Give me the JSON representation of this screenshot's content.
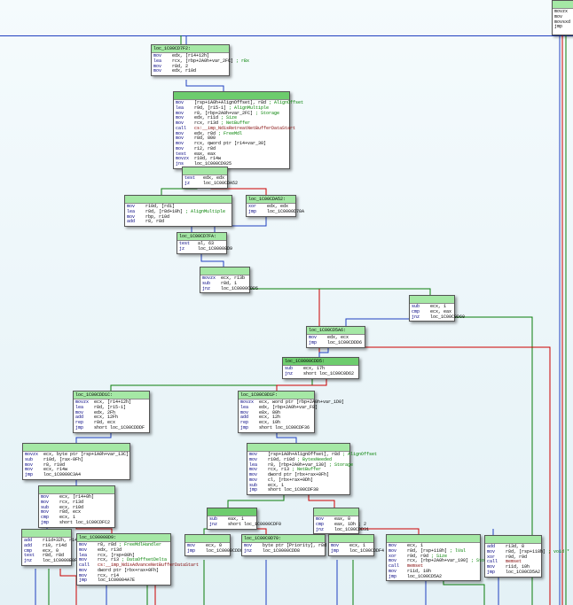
{
  "rf": [
    "movzx",
    "mov",
    "movsxd",
    "jmp"
  ],
  "n1": {
    "label": "loc_1C00CD7F2:",
    "lines": [
      {
        "op": "mov",
        "a": "edx, [r14+12h]"
      },
      {
        "op": "lea",
        "a": "rcx, [rbp+2A0h+var_2FC]",
        "c": "; rBx"
      },
      {
        "op": "mov",
        "a": "r8d, 2"
      },
      {
        "op": "mov",
        "a": "edx, r10d"
      }
    ]
  },
  "n2": {
    "lines": [
      {
        "op": "mov",
        "a": "[rsp+1A0h+AlignOffset], r8d",
        "c": "; AlignOffset"
      },
      {
        "op": "lea",
        "a": "r9d, [r15-1]",
        "c": "; AlignMultiple"
      },
      {
        "op": "mov",
        "a": "r8, [rbp+2A0h+var_2FC]",
        "c": "; Storage"
      },
      {
        "op": "mov",
        "a": "edx, r11d",
        "c": "; Size"
      },
      {
        "op": "mov",
        "a": "rcx, r13d",
        "c": "; NetBuffer"
      },
      {
        "op": "call",
        "a": "",
        "fn": "cs:__imp_NdisRetreatNetBufferDataStart"
      },
      {
        "op": "mov",
        "a": "edx, r8d",
        "c": "; FreeMdl"
      },
      {
        "op": "mov",
        "a": "r8d, 800"
      },
      {
        "op": "mov",
        "a": "rcx, qword ptr [r14+var_30]"
      },
      {
        "op": "mov",
        "a": "r12, r8d"
      },
      {
        "op": "test",
        "a": "eax, eax"
      },
      {
        "op": "movzx",
        "a": "r10d, r14w"
      },
      {
        "op": "jns",
        "a": "loc_1C000CD925"
      }
    ]
  },
  "pill": {
    "lines": [
      {
        "op": "test",
        "a": "edx, edx"
      },
      {
        "op": "jz",
        "a": "loc_1C00CDA52"
      }
    ]
  },
  "n3a": {
    "lines": [
      {
        "op": "mov",
        "a": "r10d, [rdi]",
        "c": ""
      },
      {
        "op": "lea",
        "a": "r8d, [r8d+10h]",
        "c": "; AlignMultiple"
      },
      {
        "op": "mov",
        "a": "rbp, r10d"
      },
      {
        "op": "add",
        "a": "r8, r8d"
      }
    ]
  },
  "n3b": {
    "label": "loc_1C00CDA52:",
    "lines": [
      {
        "op": "xor",
        "a": "edx, edx"
      },
      {
        "op": "jmp",
        "a": "loc_1C0000D70A"
      }
    ]
  },
  "n4": {
    "label": "loc_1C00CD7FA:",
    "lines": [
      {
        "op": "test",
        "a": "al, 63"
      },
      {
        "op": "jz",
        "a": "loc_1C00008D9"
      }
    ]
  },
  "n5": {
    "lines": [
      {
        "op": "movzx",
        "a": "ecx, r13b"
      },
      {
        "op": "sub",
        "a": "r8d, 1"
      },
      {
        "op": "jnz",
        "a": "loc_1C0000CDD5"
      }
    ]
  },
  "n6b": {
    "lines": [
      {
        "op": "sub",
        "a": "ecx, 1"
      },
      {
        "op": "cmp",
        "a": "ecx, eax"
      },
      {
        "op": "jnz",
        "a": "loc_1C00C0D60"
      }
    ]
  },
  "n7": {
    "label": "loc_1C00CD5A6:",
    "lines": [
      {
        "op": "mov",
        "a": "edx, ecx"
      },
      {
        "op": "jmp",
        "a": "loc_1C00CDDD6"
      }
    ]
  },
  "n8": {
    "label": "loc_1C0000CDD5:",
    "lines": [
      {
        "op": "sub",
        "a": "ecx, 17h"
      },
      {
        "op": "jnz",
        "a": "short loc_1C00C0D62"
      }
    ]
  },
  "n9a": {
    "label": "loc_1C00CDD1C:",
    "lines": [
      {
        "op": "movzx",
        "a": "ecx, [r14+12h]"
      },
      {
        "op": "lea",
        "a": "r8d, [r15-1]"
      },
      {
        "op": "mov",
        "a": "edx, 2Fh"
      },
      {
        "op": "add",
        "a": "ecx, 12Fh"
      },
      {
        "op": "rep",
        "a": "r8d, ecx"
      },
      {
        "op": "jmp",
        "a": "short loc_1C00CDDDF"
      }
    ]
  },
  "n9b": {
    "label": "loc_1C00C0D1F:",
    "lines": [
      {
        "op": "movzx",
        "a": "ecx, word ptr [rbp+2A0h+var_1D0]"
      },
      {
        "op": "lea",
        "a": "edx, [rbp+2A0h+var_F8]"
      },
      {
        "op": "mov",
        "a": "e8x, 80h"
      },
      {
        "op": "add",
        "a": "ecx, 12h"
      },
      {
        "op": "rep",
        "a": "ecx, 10h"
      },
      {
        "op": "jmp",
        "a": "short loc_1C00CDF36"
      }
    ]
  },
  "n10a": {
    "lines": [
      {
        "op": "movzx",
        "a": "ecx, byte ptr [rsp+1A0h+var_13C]"
      },
      {
        "op": "sub",
        "a": "r10d, [rax-0Fh]"
      },
      {
        "op": "mov",
        "a": "r8, r10d"
      },
      {
        "op": "mov",
        "a": "ecx, r14w"
      },
      {
        "op": "jmp",
        "a": "loc_1C0000C3A4"
      }
    ]
  },
  "n10b": {
    "lines": [
      {
        "op": "mov",
        "a": "[rsp+1A0h+AlignOffset], r8d",
        "c": "; AlignOffset"
      },
      {
        "op": "mov",
        "a": "r10d, r10d",
        "c": "; BytesNeeded"
      },
      {
        "op": "lea",
        "a": "r8, [rbp+2A0h+var_130]",
        "c": "; Storage"
      },
      {
        "op": "mov",
        "a": "rcx, r13",
        "c": "; NetBuffer"
      },
      {
        "op": "mov",
        "a": "dword ptr [rbx+rax+0Fh]"
      },
      {
        "op": "mov",
        "a": "cl, [rbx+rax+0Dh]"
      },
      {
        "op": "sub",
        "a": "ecx, 1"
      },
      {
        "op": "jmp",
        "a": "short loc_1C00CDF38"
      }
    ]
  },
  "n11a": {
    "lines": [
      {
        "op": "mov",
        "a": "ecx, [r14+0h]"
      },
      {
        "op": "mov",
        "a": "rcx, r13d"
      },
      {
        "op": "sub",
        "a": "ecx, r10d"
      },
      {
        "op": "mov",
        "a": "r8d, ecx"
      },
      {
        "op": "cmp",
        "a": "ecx, 1"
      },
      {
        "op": "jmp",
        "a": "short loc_1C00CDFC2"
      }
    ]
  },
  "n11b": {
    "lines": [
      {
        "op": "sub",
        "a": "eax, 1"
      },
      {
        "op": "jnz",
        "a": "short loc_1C0000CDF0"
      }
    ]
  },
  "n11c": {
    "lines": [
      {
        "op": "mov",
        "a": "eax, 0"
      },
      {
        "op": "cmp",
        "a": "eax, 1Dh ; 2"
      },
      {
        "op": "jnz",
        "a": "loc_1C00CDD31"
      }
    ]
  },
  "n12a": {
    "lines": [
      {
        "op": "add",
        "a": "r11d+32h, r14d"
      },
      {
        "op": "add",
        "a": "r10, r14d"
      },
      {
        "op": "cmp",
        "a": "ecx, 0"
      },
      {
        "op": "test",
        "a": "r8d, r8d"
      },
      {
        "op": "jnz",
        "a": "loc_1C0000E0FC"
      }
    ]
  },
  "n12b": {
    "label": "loc_1C00008D9:",
    "lines": [
      {
        "op": "mov",
        "a": "r8, r8d",
        "c": "; FreeMdlHandler"
      },
      {
        "op": "mov",
        "a": "edx, r13d"
      },
      {
        "op": "lea",
        "a": "rcx, [rsp+80h]"
      },
      {
        "op": "mov",
        "a": "rcx, r13",
        "c": "; DataOffsetDelta"
      },
      {
        "op": "call",
        "a": "",
        "fn": "cs:__imp_NdisAdvanceNetBufferDataStart"
      },
      {
        "op": "mov",
        "a": "dword ptr [rbx+rax+0Fh]"
      },
      {
        "op": "mov",
        "a": "rcx, r14"
      },
      {
        "op": "jmp",
        "a": "loc_1C00004A7E"
      }
    ]
  },
  "n12e": {
    "lines": [
      {
        "op": "mov",
        "a": "ecx, 0"
      },
      {
        "op": "jmp",
        "a": "loc_1C0000CDD8"
      }
    ]
  },
  "n12f": {
    "label": "loc_1C00C0D70:",
    "lines": [
      {
        "op": "mov",
        "a": "byte ptr [Priority], r8d"
      },
      {
        "op": "jnz",
        "a": "loc_1C0000CDD8"
      }
    ]
  },
  "n12g": {
    "lines": [
      {
        "op": "mov",
        "a": "ecx, 1"
      },
      {
        "op": "jmp",
        "a": "loc_1C00CDDF4"
      }
    ]
  },
  "n12h": {
    "lines": [
      {
        "op": "mov",
        "a": "ecx, 1"
      },
      {
        "op": "mov",
        "a": "r8d, [rsp+118h]",
        "c": "; lVal"
      },
      {
        "op": "xor",
        "a": "r9d, r9d",
        "c": "; Size"
      },
      {
        "op": "mov",
        "a": "rcx, [rbp+2A0h+var_190]",
        "c": "; Storage"
      },
      {
        "op": "call",
        "a": "",
        "fn": "memset"
      },
      {
        "op": "mov",
        "a": "r11d, 10h"
      },
      {
        "op": "jmp",
        "a": "loc_1C00CD5A2"
      }
    ]
  },
  "n12i": {
    "lines": [
      {
        "op": "add",
        "a": "r13d, 8"
      },
      {
        "op": "mov",
        "a": "r8d, [rsp+118h]",
        "c": "; void *"
      },
      {
        "op": "xor",
        "a": "r9d, r9d"
      },
      {
        "op": "call",
        "a": "",
        "fn": "memset"
      },
      {
        "op": "mov",
        "a": "r11d, 10h"
      },
      {
        "op": "jmp",
        "a": "loc_1C00CD5A2"
      }
    ]
  }
}
